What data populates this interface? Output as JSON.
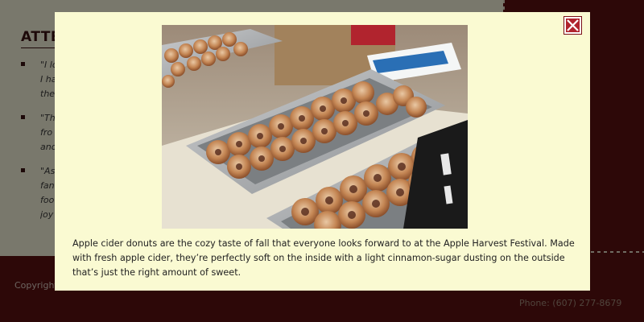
{
  "background_page": {
    "heading": "ATTE",
    "testimonials": [
      {
        "text": "\"I lo\nI ha\nthe"
      },
      {
        "text": "\"Th\nfro\nand"
      },
      {
        "text": "\"As\nfan\nfoo\njoy"
      }
    ],
    "footer": {
      "copyright": "Copyright",
      "phone": "Phone: (607) 277-8679"
    }
  },
  "modal": {
    "close_icon": "close-icon",
    "image_subject": "donuts-photo",
    "caption": "Apple cider donuts are the cozy taste of fall that everyone looks forward to at the Apple Harvest Festival. Made with fresh apple cider, they’re perfectly soft on the inside with a light cinnamon-sugar dusting on the outside that’s just the right amount of sweet."
  },
  "colors": {
    "maroon": "#5a1010",
    "cream": "#fafad2",
    "close_red": "#b1242e"
  }
}
